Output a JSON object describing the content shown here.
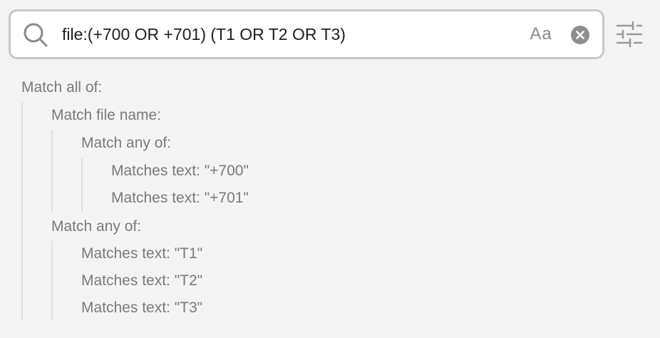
{
  "search": {
    "query": "file:(+700 OR +701) (T1 OR T2 OR T3)",
    "case_toggle_label": "Aa"
  },
  "tree": {
    "root_label": "Match all of:",
    "file_group_label": "Match file name:",
    "file_any_label": "Match any of:",
    "file_items": [
      "Matches text: \"+700\"",
      "Matches text: \"+701\""
    ],
    "any_group_label": "Match any of:",
    "any_items": [
      "Matches text: \"T1\"",
      "Matches text: \"T2\"",
      "Matches text: \"T3\""
    ]
  },
  "icons": {
    "search": "search-icon",
    "clear": "clear-icon",
    "filter": "sliders-icon"
  },
  "colors": {
    "background": "#f4f4f4",
    "input_border": "#c9c9c9",
    "query_text": "#1e1e1e",
    "tree_text": "#7a7a7a",
    "clear_icon": "#8e8e8e"
  }
}
